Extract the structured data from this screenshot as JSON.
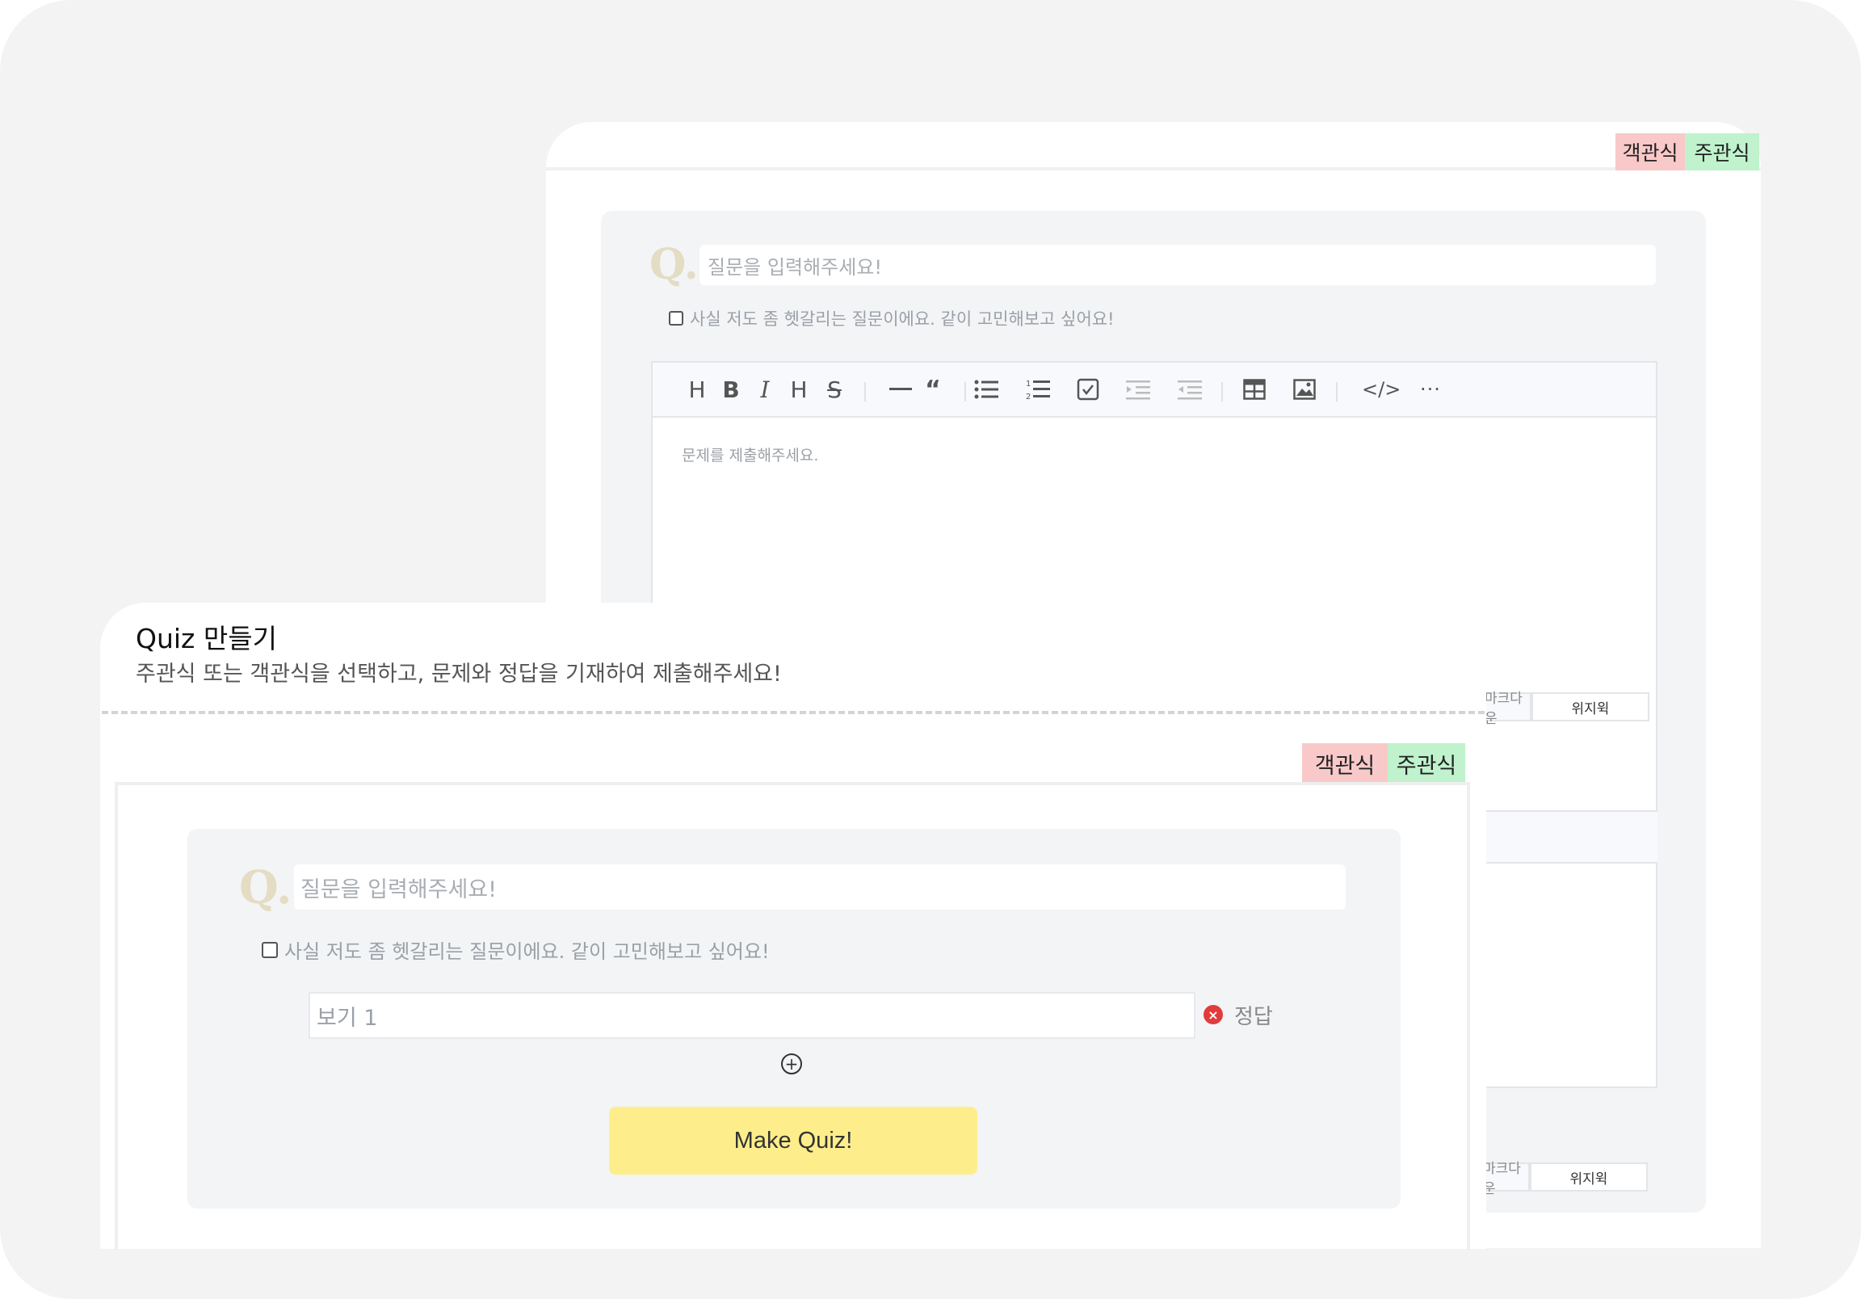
{
  "back_panel": {
    "tabs": {
      "multiple_choice": "객관식",
      "short_answer": "주관식"
    },
    "question_placeholder": "질문을 입력해주세요!",
    "confused_label": "사실 저도 좀 헷갈리는 질문이에요. 같이 고민해보고 싶어요!",
    "editor": {
      "placeholder": "문제를 제출해주세요.",
      "mode_markdown": "마크다운",
      "mode_wysiwyg": "위지윅",
      "toolbar_icons": [
        "heading-icon",
        "bold-icon",
        "italic-icon",
        "strike-icon",
        "hr-icon",
        "quote-icon",
        "bullet-list-icon",
        "ordered-list-icon",
        "task-list-icon",
        "indent-icon",
        "outdent-icon",
        "table-icon",
        "image-icon",
        "code-icon",
        "more-icon"
      ]
    }
  },
  "front_panel": {
    "title": "Quiz 만들기",
    "subtitle": "주관식 또는 객관식을 선택하고, 문제와 정답을 기재하여 제출해주세요!",
    "tabs": {
      "multiple_choice": "객관식",
      "short_answer": "주관식"
    },
    "question_placeholder": "질문을 입력해주세요!",
    "confused_label": "사실 저도 좀 헷갈리는 질문이에요. 같이 고민해보고 싶어요!",
    "options": [
      {
        "placeholder": "보기 1",
        "answer_label": "정답"
      }
    ],
    "submit_label": "Make Quiz!"
  },
  "colors": {
    "tab_multiple_choice": "#f9c9c9",
    "tab_short_answer": "#bff2cd",
    "submit_button": "#fdee8b",
    "delete_icon": "#e23b3b"
  }
}
